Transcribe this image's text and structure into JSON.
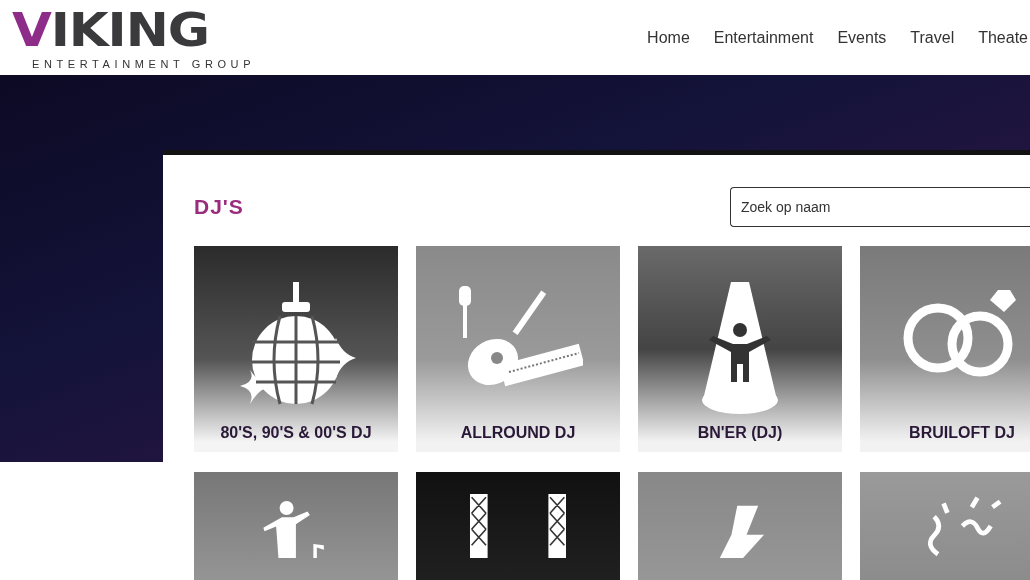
{
  "logo": {
    "name": "VIKING",
    "tagline": "ENTERTAINMENT GROUP"
  },
  "nav": [
    {
      "label": "Home"
    },
    {
      "label": "Entertainment"
    },
    {
      "label": "Events"
    },
    {
      "label": "Travel"
    },
    {
      "label": "Theate"
    }
  ],
  "section": {
    "title": "DJ'S",
    "search": {
      "placeholder": "Zoek op naam"
    }
  },
  "categories": [
    {
      "kind": "captioned",
      "label": "80'S, 90'S & 00'S DJ"
    },
    {
      "kind": "captioned",
      "label": "ALLROUND DJ"
    },
    {
      "kind": "captioned",
      "label": "BN'ER (DJ)"
    },
    {
      "kind": "captioned",
      "label": "BRUILOFT DJ"
    },
    {
      "kind": "cropped"
    },
    {
      "kind": "cropped"
    },
    {
      "kind": "cropped"
    },
    {
      "kind": "cropped"
    }
  ]
}
